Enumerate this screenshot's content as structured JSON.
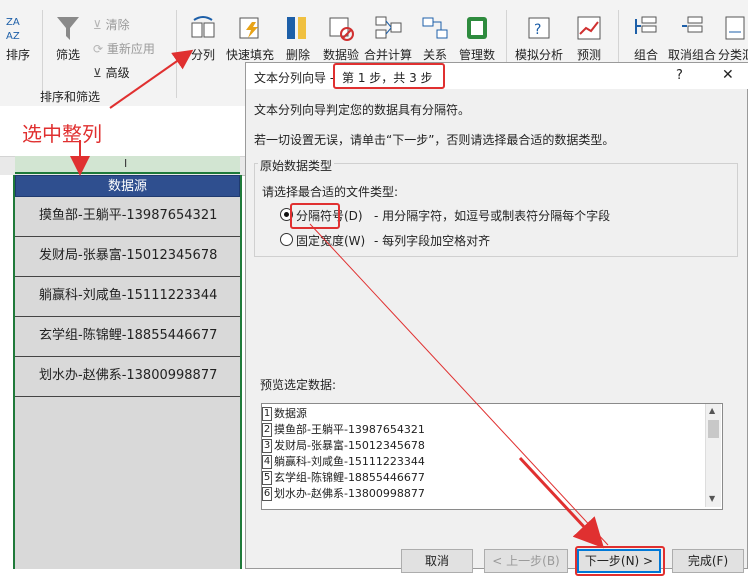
{
  "ribbon": {
    "sort_label": "排序",
    "filter_label": "筛选",
    "clear_label": "清除",
    "reapply_label": "重新应用",
    "advanced_label": "高级",
    "group_sort_filter": "排序和筛选",
    "text_to_columns_label": "分列",
    "flash_fill_label": "快速填充",
    "remove_duplicates_label": "删除",
    "data_validation_label": "数据验",
    "consolidate_label": "合并计算",
    "relationships_label": "关系",
    "data_model_label": "管理数",
    "what_if_label": "模拟分析",
    "forecast_label": "预测",
    "group_label": "组合",
    "ungroup_label": "取消组合",
    "subtotal_label": "分类汇"
  },
  "annotation": {
    "select_column": "选中整列"
  },
  "sheet": {
    "column_letter": "I",
    "header": "数据源",
    "rows": [
      "摸鱼部-王躺平-13987654321",
      "发财局-张暴富-15012345678",
      "躺赢科-刘咸鱼-15111223344",
      "玄学组-陈锦鲤-18855446677",
      "划水办-赵佛系-13800998877"
    ]
  },
  "dialog": {
    "title": "文本分列向导 - 第 1 步，共 3 步",
    "title_prefix": "文本分列向导 - ",
    "title_step": "第 1 步，共 3 步",
    "help": "?",
    "close": "✕",
    "intro1": "文本分列向导判定您的数据具有分隔符。",
    "intro2": "若一切设置无误，请单击“下一步”，否则请选择最合适的数据类型。",
    "group_title": "原始数据类型",
    "choose_label": "请选择最合适的文件类型:",
    "option_delimited": "分隔符号(D)",
    "option_delimited_desc": "- 用分隔字符，如逗号或制表符分隔每个字段",
    "option_fixed": "固定宽度(W)",
    "option_fixed_desc": "- 每列字段加空格对齐",
    "selected_option": "delimited",
    "preview_label": "预览选定数据:",
    "preview_rows": [
      {
        "n": "1",
        "text": "数据源"
      },
      {
        "n": "2",
        "text": "摸鱼部-王躺平-13987654321"
      },
      {
        "n": "3",
        "text": "发财局-张暴富-15012345678"
      },
      {
        "n": "4",
        "text": "躺赢科-刘咸鱼-15111223344"
      },
      {
        "n": "5",
        "text": "玄学组-陈锦鲤-18855446677"
      },
      {
        "n": "6",
        "text": "划水办-赵佛系-13800998877"
      }
    ],
    "btn_cancel": "取消",
    "btn_back": "< 上一步(B)",
    "btn_next": "下一步(N) >",
    "btn_finish": "完成(F)"
  },
  "colors": {
    "header_fill": "#2f4f8f",
    "cell_fill": "#d9d9d9",
    "annotation_red": "#e03030",
    "primary_border": "#0078d7"
  }
}
